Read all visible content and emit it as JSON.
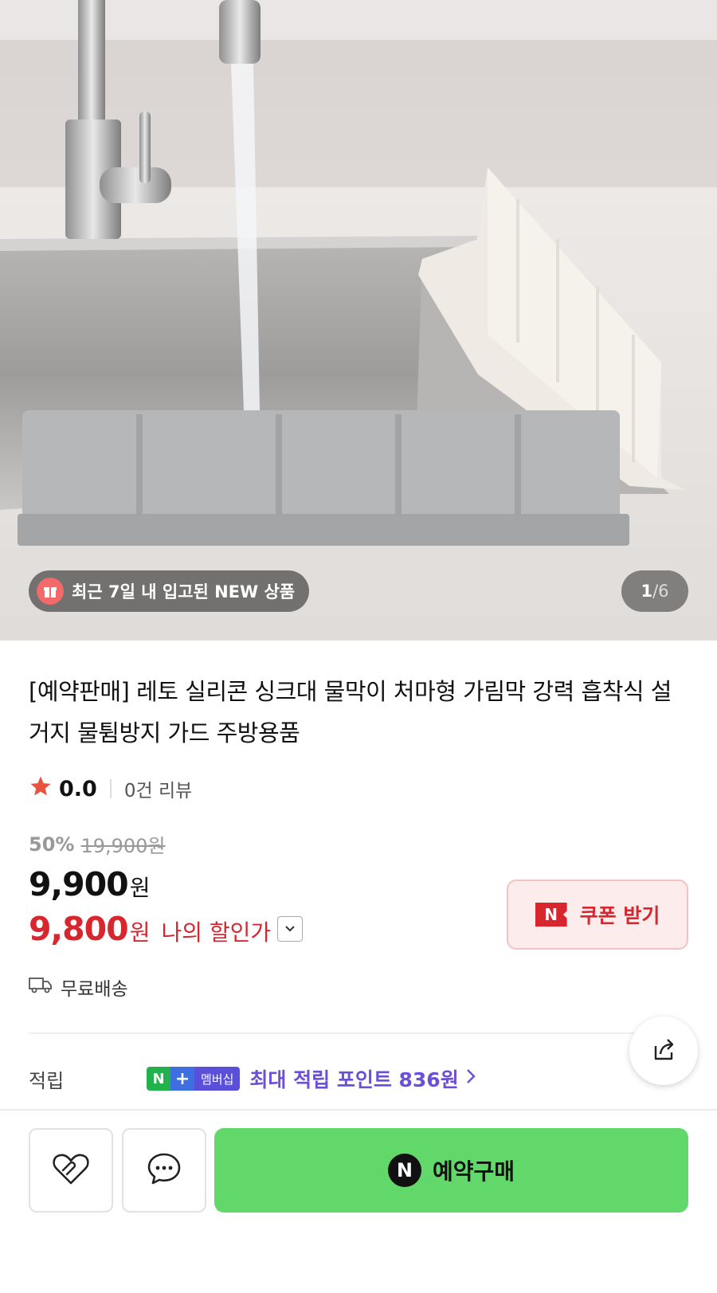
{
  "image": {
    "new_badge": "최근 7일 내 입고된 NEW 상품",
    "counter_current": "1",
    "counter_sep": "/",
    "counter_total": "6"
  },
  "product": {
    "title": "[예약판매] 레토 실리콘 싱크대 물막이 처마형 가림막 강력 흡착식 설거지 물튐방지 가드 주방용품",
    "rating": "0.0",
    "review_count": "0건 리뷰",
    "discount_pct": "50%",
    "original_price": "19,900원",
    "price": "9,900",
    "price_unit": "원",
    "my_price": "9,800",
    "my_price_unit": "원",
    "my_price_label": "나의 할인가",
    "shipping": "무료배송"
  },
  "coupon": {
    "label": "쿠폰 받기",
    "ticket_letter": "N"
  },
  "points": {
    "label": "적립",
    "badge_n": "N",
    "badge_plus": "+",
    "badge_membership": "멤버십",
    "text": "최대 적립 포인트 836원"
  },
  "actions": {
    "buy_label": "예약구매",
    "buy_letter": "N"
  },
  "colors": {
    "accent_red": "#d8262f",
    "buy_green": "#62d86b",
    "points_purple": "#6b4fd8",
    "star": "#e8533f"
  },
  "icons": [
    "gift-icon",
    "star-icon",
    "chevron-down-icon",
    "truck-icon",
    "share-icon",
    "chevron-right-icon",
    "heart-icon",
    "chat-icon",
    "naver-n-icon"
  ]
}
